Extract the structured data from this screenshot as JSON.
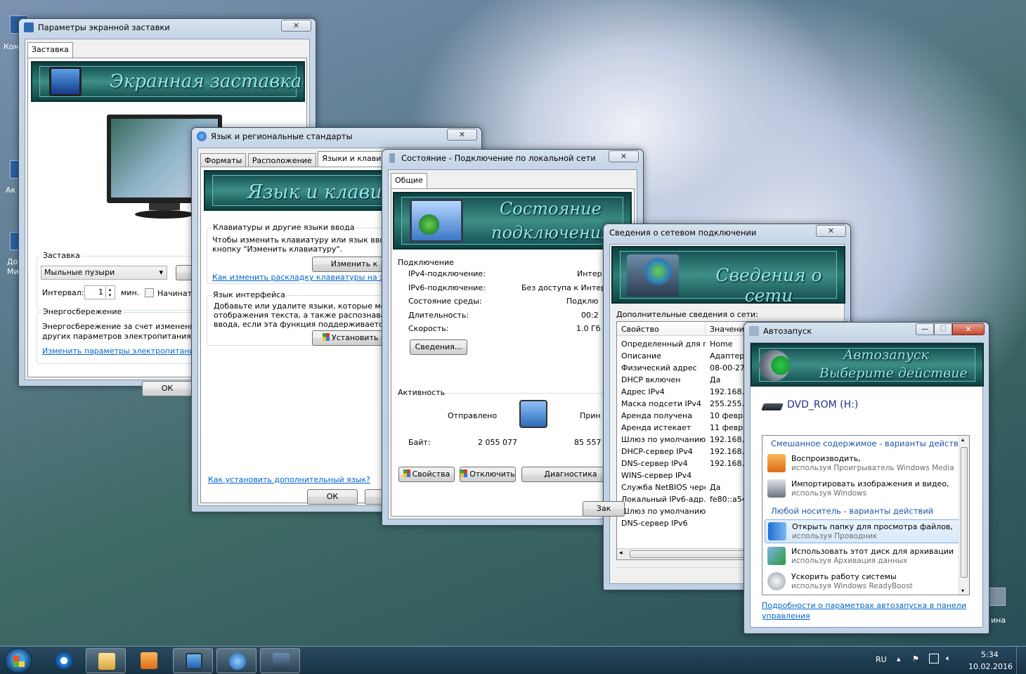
{
  "desktop": {
    "labels": [
      "Ком",
      "Ак",
      "До",
      "Ми",
      "ина"
    ]
  },
  "screensaver_window": {
    "title": "Параметры экранной заставки",
    "close": "✕",
    "tab": "Заставка",
    "banner": "Экранная заставка",
    "group_saver": "Заставка",
    "saver_value": "Мыльные пузыри",
    "params_btn": "Пар",
    "interval_label": "Интервал:",
    "interval_value": "1",
    "minutes": "мин.",
    "start_label": "Начинать",
    "group_energy": "Энергосбережение",
    "energy_text1": "Энергосбережение за счет изменения ярк",
    "energy_text2": "других параметров электропитания.",
    "energy_link": "Изменить параметры электропитания...",
    "ok": "ОК"
  },
  "region_window": {
    "title": "Язык и региональные стандарты",
    "close": "✕",
    "tabs": [
      "Форматы",
      "Расположение",
      "Языки и клавиатур"
    ],
    "banner": "Язык и клавиат",
    "group_keyboards": "Клавиатуры и другие языки ввода",
    "kb_text1": "Чтобы изменить клавиатуру или язык ввода т",
    "kb_text2": "кнопку \"Изменить клавиатуру\".",
    "change_btn": "Изменить к",
    "kb_link": "Как изменить раскладку клавиатуры на экра",
    "group_ui": "Язык интерфейса",
    "ui_text1": "Добавьте или удалите языки, которые могут",
    "ui_text2": "отображения текста, а также распознавания",
    "ui_text3": "ввода, если эта функция поддерживается.",
    "install_btn": "Установить и",
    "lang_link": "Как установить дополнительный язык?",
    "ok": "ОК",
    "cancel": "О"
  },
  "status_window": {
    "title": "Состояние - Подключение по локальной сети",
    "close": "✕",
    "tab": "Общие",
    "banner1": "Состояние",
    "banner2": "подключения",
    "section_connection": "Подключение",
    "rows": [
      {
        "k": "IPv4-подключение:",
        "v": "Интер"
      },
      {
        "k": "IPv6-подключение:",
        "v": "Без доступа к Интерн"
      },
      {
        "k": "Состояние среды:",
        "v": "Подклю"
      },
      {
        "k": "Длительность:",
        "v": "00:2"
      },
      {
        "k": "Скорость:",
        "v": "1.0 Гб"
      }
    ],
    "details_btn": "Сведения...",
    "section_activity": "Активность",
    "sent": "Отправлено",
    "received": "Прин",
    "bytes": "Байт:",
    "bytes_sent": "2 055 077",
    "bytes_recv": "85 557",
    "props_btn": "Свойства",
    "disable_btn": "Отключить",
    "diag_btn": "Диагностика"
  },
  "details_window": {
    "title": "Сведения о сетевом подключении",
    "close": "✕",
    "banner": "Сведения о сети",
    "subtitle": "Дополнительные сведения о сети:",
    "columns": [
      "Свойство",
      "Значение"
    ],
    "rows": [
      {
        "k": "Определенный для п...",
        "v": "Home"
      },
      {
        "k": "Описание",
        "v": "Адаптер р"
      },
      {
        "k": "Физический адрес",
        "v": "08-00-27-"
      },
      {
        "k": "DHCP включен",
        "v": "Да"
      },
      {
        "k": "Адрес IPv4",
        "v": "192.168.1"
      },
      {
        "k": "Маска подсети IPv4",
        "v": "255.255.2"
      },
      {
        "k": "Аренда получена",
        "v": "10 февра"
      },
      {
        "k": "Аренда истекает",
        "v": "11 февра"
      },
      {
        "k": "Шлюз по умолчанию I...",
        "v": "192.168.1"
      },
      {
        "k": "DHCP-сервер IPv4",
        "v": "192.168.1"
      },
      {
        "k": "DNS-сервер IPv4",
        "v": "192.168.1"
      },
      {
        "k": "WINS-сервер IPv4",
        "v": ""
      },
      {
        "k": "Служба NetBIOS чере...",
        "v": "Да"
      },
      {
        "k": "Локальный IPv6-адр...",
        "v": "fe80::a54"
      },
      {
        "k": "Шлюз по умолчанию I...",
        "v": ""
      },
      {
        "k": "DNS-сервер IPv6",
        "v": ""
      }
    ],
    "close_btn": "Зак"
  },
  "autoplay_window": {
    "title": "Автозапуск",
    "min": "—",
    "max": "☐",
    "close": "✕",
    "banner1": "Автозапуск",
    "banner2": "Выберите действие",
    "drive": "DVD_ROM (H:)",
    "section_mixed": "Смешанное содержимое - варианты действ...",
    "items_mixed": [
      {
        "a": "Воспроизводить,",
        "b": "используя Проигрыватель Windows Media",
        "icon": "media-player-icon"
      },
      {
        "a": "Импортировать изображения и видео,",
        "b": "используя Windows",
        "icon": "camera-icon"
      }
    ],
    "section_any": "Любой носитель - варианты действий",
    "items_any": [
      {
        "a": "Открыть папку для просмотра файлов,",
        "b": "используя Проводник",
        "icon": "folder-icon"
      },
      {
        "a": "Использовать этот диск для архивации",
        "b": "используя Архивация данных",
        "icon": "backup-icon"
      },
      {
        "a": "Ускорить работу системы",
        "b": "используя Windows ReadyBoost",
        "icon": "readyboost-icon"
      }
    ],
    "link1": "Подробности о параметрах автозапуска в панели",
    "link2": "управления"
  },
  "taskbar": {
    "lang": "RU",
    "time": "5:34",
    "date": "10.02.2016"
  }
}
